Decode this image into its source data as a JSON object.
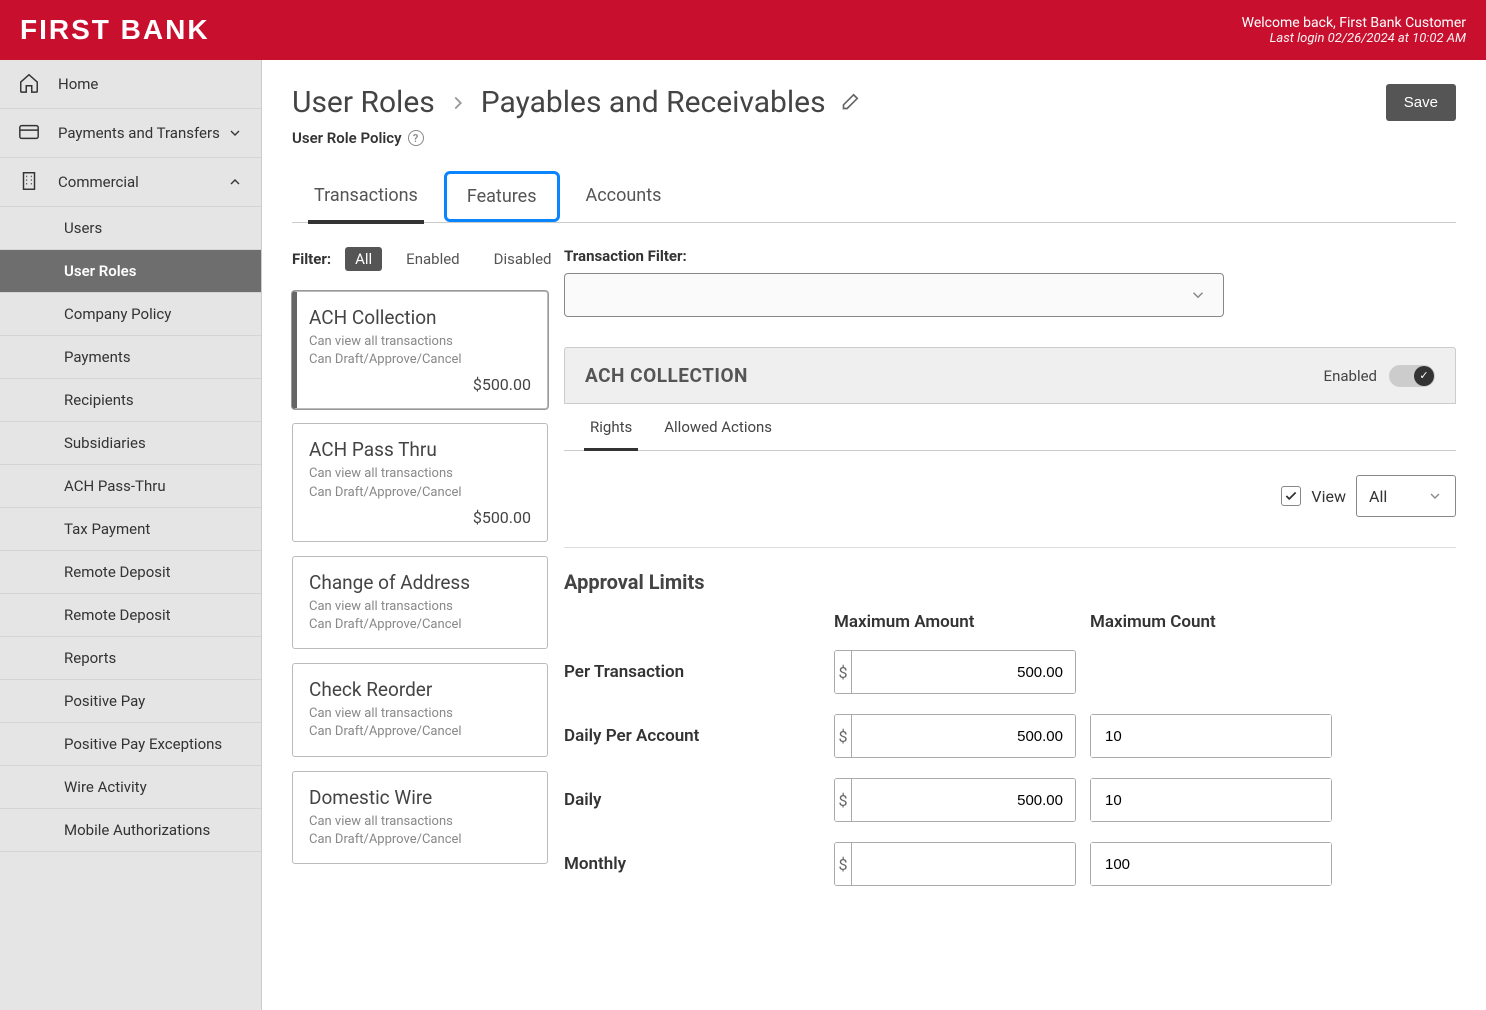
{
  "header": {
    "logo": "FIRST BANK",
    "welcome": "Welcome back, First Bank Customer",
    "last_login": "Last login 02/26/2024 at 10:02 AM"
  },
  "sidebar": {
    "home": "Home",
    "payments": "Payments and Transfers",
    "commercial": "Commercial",
    "items": [
      {
        "label": "Users"
      },
      {
        "label": "User Roles"
      },
      {
        "label": "Company Policy"
      },
      {
        "label": "Payments"
      },
      {
        "label": "Recipients"
      },
      {
        "label": "Subsidiaries"
      },
      {
        "label": "ACH Pass-Thru"
      },
      {
        "label": "Tax Payment"
      },
      {
        "label": "Remote Deposit"
      },
      {
        "label": "Remote Deposit"
      },
      {
        "label": "Reports"
      },
      {
        "label": "Positive Pay"
      },
      {
        "label": "Positive Pay Exceptions"
      },
      {
        "label": "Wire Activity"
      },
      {
        "label": "Mobile Authorizations"
      }
    ]
  },
  "breadcrumb": {
    "root": "User Roles",
    "current": "Payables and Receivables",
    "save": "Save"
  },
  "subtitle": "User Role Policy",
  "tabs": {
    "transactions": "Transactions",
    "features": "Features",
    "accounts": "Accounts"
  },
  "filter": {
    "label": "Filter:",
    "all": "All",
    "enabled": "Enabled",
    "disabled": "Disabled"
  },
  "trans_filter_label": "Transaction Filter:",
  "cards": [
    {
      "title": "ACH Collection",
      "sub1": "Can view all transactions",
      "sub2": "Can Draft/Approve/Cancel",
      "amount": "$500.00"
    },
    {
      "title": "ACH Pass Thru",
      "sub1": "Can view all transactions",
      "sub2": "Can Draft/Approve/Cancel",
      "amount": "$500.00"
    },
    {
      "title": "Change of Address",
      "sub1": "Can view all transactions",
      "sub2": "Can Draft/Approve/Cancel",
      "amount": ""
    },
    {
      "title": "Check Reorder",
      "sub1": "Can view all transactions",
      "sub2": "Can Draft/Approve/Cancel",
      "amount": ""
    },
    {
      "title": "Domestic Wire",
      "sub1": "Can view all transactions",
      "sub2": "Can Draft/Approve/Cancel",
      "amount": ""
    }
  ],
  "detail": {
    "title": "ACH COLLECTION",
    "enabled_label": "Enabled",
    "sub_tabs": {
      "rights": "Rights",
      "allowed": "Allowed Actions"
    },
    "view_label": "View",
    "view_select": "All",
    "approval_title": "Approval Limits",
    "col_amount": "Maximum Amount",
    "col_count": "Maximum Count",
    "rows": [
      {
        "label": "Per Transaction",
        "amount": "500.00",
        "count": ""
      },
      {
        "label": "Daily Per Account",
        "amount": "500.00",
        "count": "10"
      },
      {
        "label": "Daily",
        "amount": "500.00",
        "count": "10"
      },
      {
        "label": "Monthly",
        "amount": "",
        "count": "100"
      }
    ],
    "currency": "$"
  }
}
